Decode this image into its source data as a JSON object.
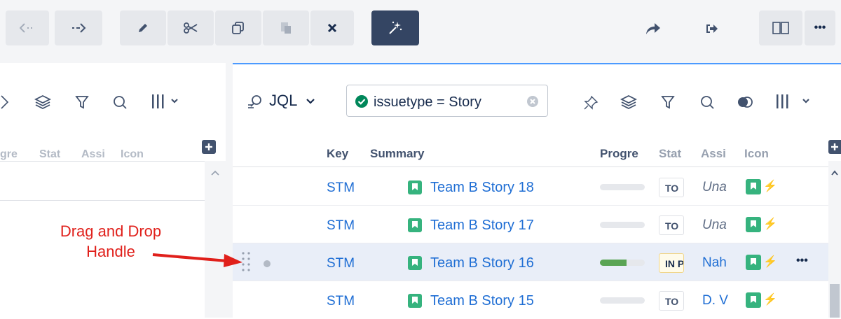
{
  "toolbar": {
    "buttons": [
      {
        "name": "back-button",
        "icon": "arrow-left-icon"
      },
      {
        "name": "forward-button",
        "icon": "arrow-right-icon"
      },
      {
        "name": "edit-button",
        "icon": "pencil-icon"
      },
      {
        "name": "cut-button",
        "icon": "scissors-icon"
      },
      {
        "name": "copy-button",
        "icon": "copy-icon"
      },
      {
        "name": "paste-button",
        "icon": "paste-icon"
      },
      {
        "name": "delete-button",
        "icon": "close-icon"
      },
      {
        "name": "magic-button",
        "icon": "magic-wand-icon"
      },
      {
        "name": "share-button",
        "icon": "share-icon"
      },
      {
        "name": "export-button",
        "icon": "sign-out-icon"
      },
      {
        "name": "split-view-button",
        "icon": "columns-icon"
      },
      {
        "name": "more-button",
        "icon": "more-icon",
        "label": "•••"
      }
    ]
  },
  "left_panel": {
    "columns": [
      "gre",
      "Stat",
      "Assi",
      "Icon"
    ]
  },
  "right_panel": {
    "query_mode": "JQL",
    "query": "issuetype = Story",
    "columns": {
      "key": "Key",
      "summary": "Summary",
      "progress": "Progre",
      "status": "Stat",
      "assignee": "Assi",
      "icon": "Icon"
    },
    "rows": [
      {
        "key": "STM",
        "summary": "Team B Story 18",
        "progress": 0,
        "status": "TO",
        "assignee": "Una",
        "assigned": false
      },
      {
        "key": "STM",
        "summary": "Team B Story 17",
        "progress": 0,
        "status": "TO",
        "assignee": "Una",
        "assigned": false
      },
      {
        "key": "STM",
        "summary": "Team B Story 16",
        "progress": 0.6,
        "status": "IN P",
        "assignee": "Nah",
        "assigned": true,
        "selected": true,
        "row_more": "•••"
      },
      {
        "key": "STM",
        "summary": "Team B Story 15",
        "progress": 0,
        "status": "TO",
        "assignee": "D. V",
        "assigned": true
      }
    ]
  },
  "annotation": {
    "line1": "Drag and Drop",
    "line2": "Handle",
    "color": "#e0201b"
  },
  "colors": {
    "accent": "#4c9aff",
    "link": "#1f6ed4",
    "story": "#36b37e",
    "progress_fill": "#5aa454",
    "filter_check": "#00875a"
  }
}
